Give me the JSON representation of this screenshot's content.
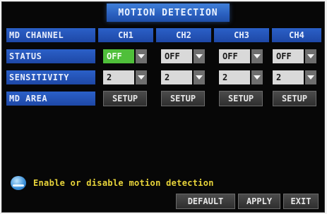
{
  "window": {
    "title": "MOTION DETECTION"
  },
  "rows": {
    "md_channel": "MD CHANNEL",
    "status": "STATUS",
    "sensitivity": "SENSITIVITY",
    "md_area": "MD AREA"
  },
  "channels": [
    {
      "name": "CH1",
      "status": "OFF",
      "sensitivity": "2",
      "area_button": "SETUP",
      "status_focused": true
    },
    {
      "name": "CH2",
      "status": "OFF",
      "sensitivity": "2",
      "area_button": "SETUP",
      "status_focused": false
    },
    {
      "name": "CH3",
      "status": "OFF",
      "sensitivity": "2",
      "area_button": "SETUP",
      "status_focused": false
    },
    {
      "name": "CH4",
      "status": "OFF",
      "sensitivity": "2",
      "area_button": "SETUP",
      "status_focused": false
    }
  ],
  "hint": {
    "icon": "info-icon",
    "text": "Enable or disable motion detection"
  },
  "footer": {
    "default_label": "DEFAULT",
    "apply_label": "APPLY",
    "exit_label": "EXIT"
  },
  "colors": {
    "header_blue": "#2a5fbf",
    "focus_green": "#4fbf3a",
    "hint_yellow": "#e8d43a"
  }
}
